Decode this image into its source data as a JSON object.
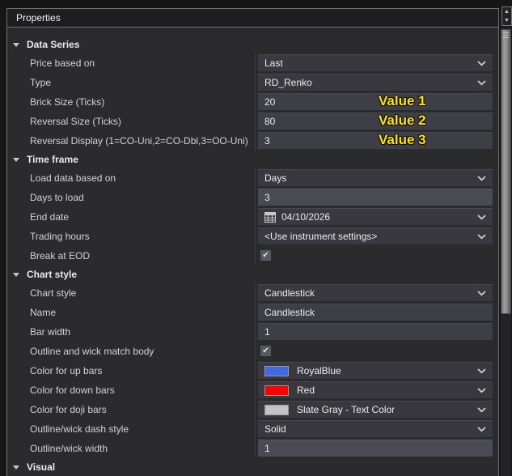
{
  "title_bar": {
    "title": "Properties"
  },
  "annotations": [
    "Value 1",
    "Value 2",
    "Value 3"
  ],
  "colors": {
    "annotation_yellow": "#ffe600",
    "up_bars_swatch": "#4169e1",
    "down_bars_swatch": "#ff0000",
    "doji_bars_swatch": "#c3c3c7"
  },
  "rows": [
    {
      "type": "section",
      "label": "Data Series"
    },
    {
      "type": "dropdown",
      "label": "Price based on",
      "value": "Last"
    },
    {
      "type": "dropdown",
      "label": "Type",
      "value": "RD_Renko"
    },
    {
      "type": "input",
      "label": "Brick Size (Ticks)",
      "value": "20",
      "annotation": "Value 1"
    },
    {
      "type": "input",
      "label": "Reversal Size (Ticks)",
      "value": "80",
      "annotation": "Value 2"
    },
    {
      "type": "input",
      "label": "Reversal Display (1=CO-Uni,2=CO-Dbl,3=OO-Uni)",
      "value": "3",
      "annotation": "Value 3"
    },
    {
      "type": "section",
      "label": "Time frame"
    },
    {
      "type": "dropdown",
      "label": "Load data based on",
      "value": "Days"
    },
    {
      "type": "input",
      "label": "Days to load",
      "value": "3"
    },
    {
      "type": "date",
      "label": "End date",
      "value": "04/10/2026"
    },
    {
      "type": "dropdown",
      "label": "Trading hours",
      "value": "<Use instrument settings>"
    },
    {
      "type": "checkbox",
      "label": "Break at EOD",
      "checked": "true"
    },
    {
      "type": "section",
      "label": "Chart style"
    },
    {
      "type": "dropdown",
      "label": "Chart style",
      "value": "Candlestick"
    },
    {
      "type": "input",
      "label": "Name",
      "value": "Candlestick"
    },
    {
      "type": "input",
      "label": "Bar width",
      "value": "1"
    },
    {
      "type": "checkbox",
      "label": "Outline and wick match body",
      "checked": "true"
    },
    {
      "type": "color",
      "label": "Color for up bars",
      "value": "RoyalBlue",
      "swatch": "#4169e1"
    },
    {
      "type": "color",
      "label": "Color for down bars",
      "value": "Red",
      "swatch": "#ff0000"
    },
    {
      "type": "color",
      "label": "Color for doji bars",
      "value": "Slate Gray - Text Color",
      "swatch": "#c3c3c7"
    },
    {
      "type": "dropdown",
      "label": "Outline/wick dash style",
      "value": "Solid"
    },
    {
      "type": "input",
      "label": "Outline/wick width",
      "value": "1"
    },
    {
      "type": "section",
      "label": "Visual"
    }
  ],
  "checkbox_glyph": "✔"
}
